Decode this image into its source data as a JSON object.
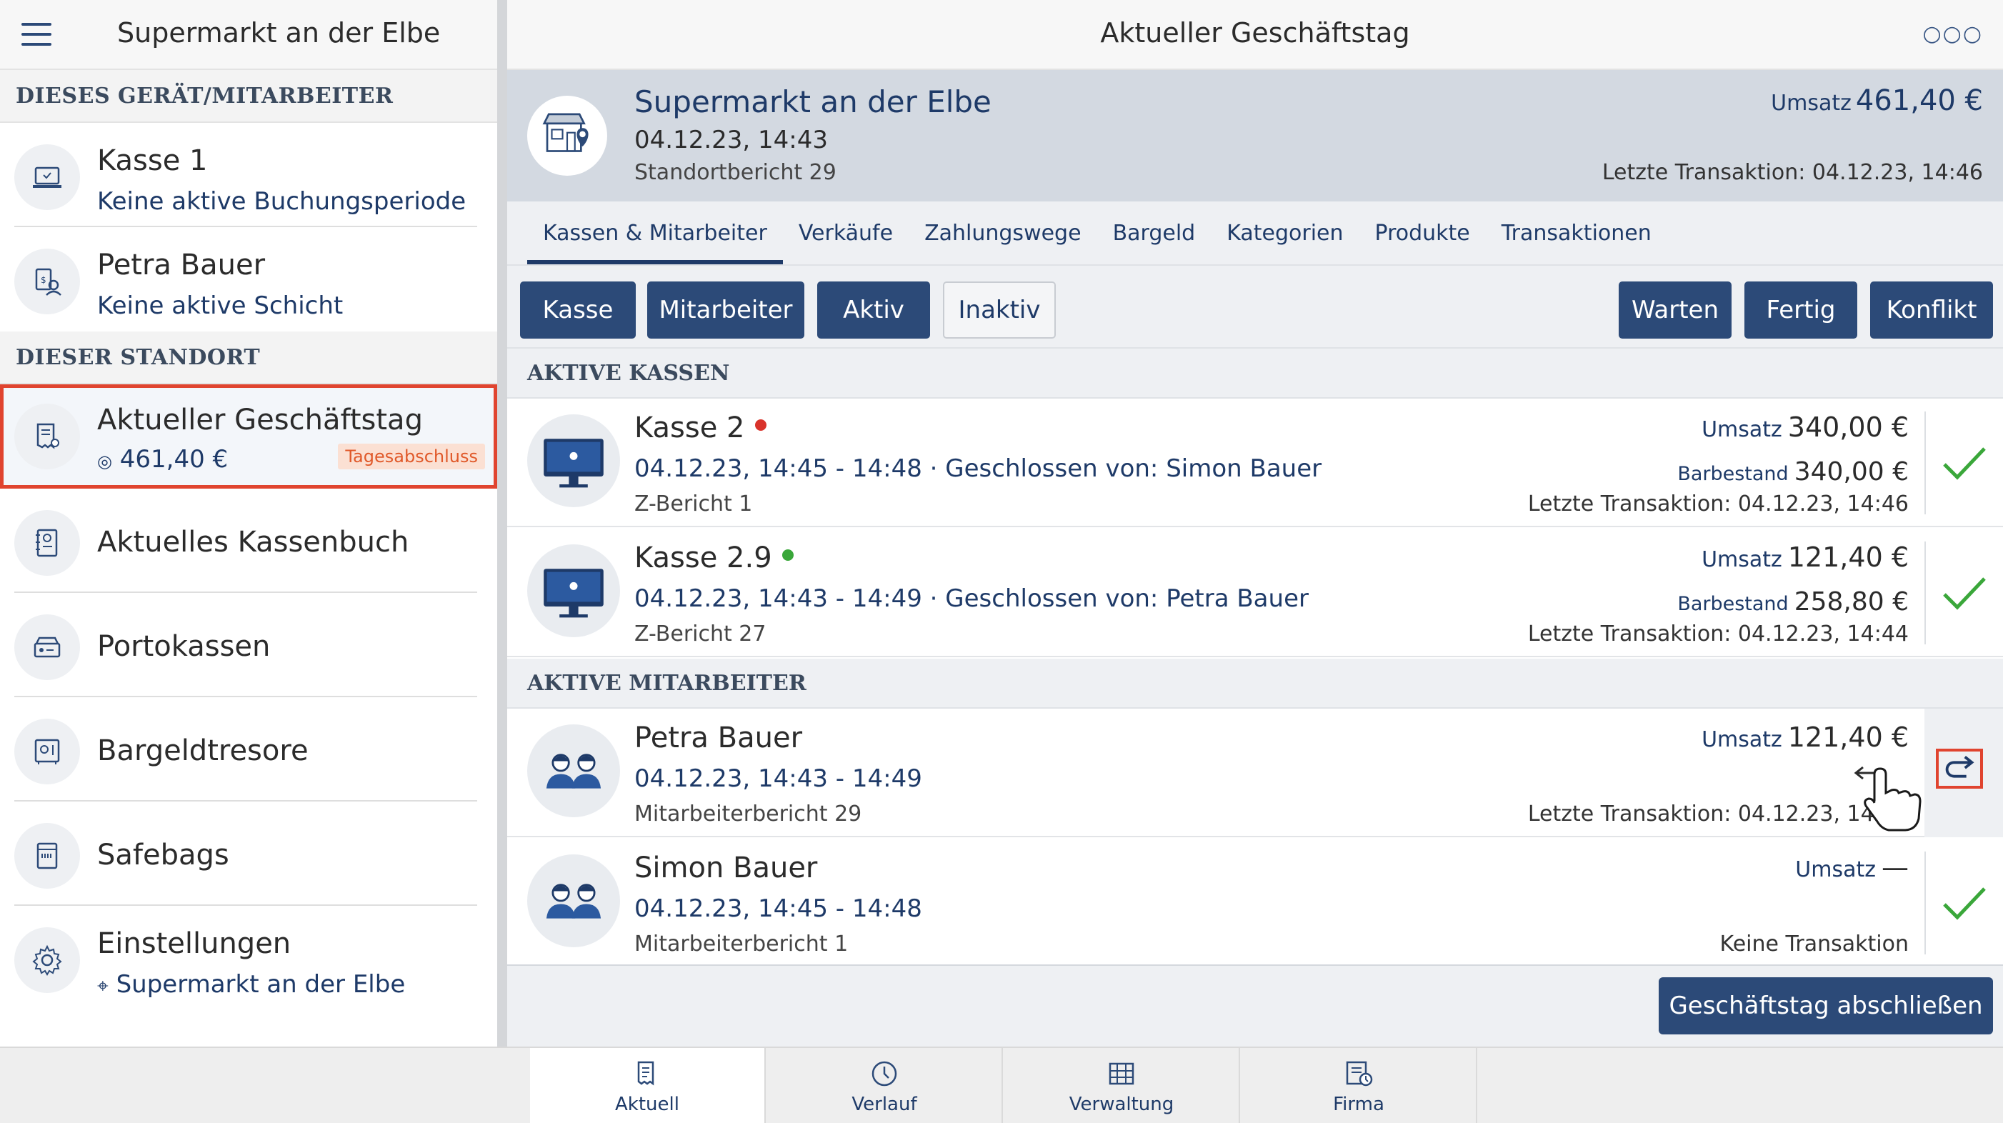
{
  "sidebar": {
    "title": "Supermarkt an der Elbe",
    "section_device": "DIESES GERÄT/MITARBEITER",
    "section_location": "DIESER STANDORT",
    "items": [
      {
        "title": "Kasse 1",
        "subtitle": "Keine aktive Buchungsperiode",
        "icon": "register-icon"
      },
      {
        "title": "Petra Bauer",
        "subtitle": "Keine aktive Schicht",
        "icon": "employee-icon"
      },
      {
        "title": "Aktueller Geschäftstag",
        "subtitle": "461,40 €",
        "badge": "Tagesabschluss",
        "icon": "receipt-icon"
      },
      {
        "title": "Aktuelles Kassenbuch",
        "icon": "cashbook-icon"
      },
      {
        "title": "Portokassen",
        "icon": "petty-cash-icon"
      },
      {
        "title": "Bargeldtresore",
        "icon": "safe-icon"
      },
      {
        "title": "Safebags",
        "icon": "safebag-icon"
      },
      {
        "title": "Einstellungen",
        "subtitle": "Supermarkt an der Elbe",
        "icon": "gear-icon"
      }
    ]
  },
  "header": {
    "title": "Aktueller Geschäftstag"
  },
  "banner": {
    "name": "Supermarkt an der Elbe",
    "date": "04.12.23, 14:43",
    "report": "Standortbericht 29",
    "revenue_label": "Umsatz",
    "revenue": "461,40 €",
    "last_transaction": "Letzte Transaktion: 04.12.23, 14:46"
  },
  "tabs": [
    "Kassen & Mitarbeiter",
    "Verkäufe",
    "Zahlungswege",
    "Bargeld",
    "Kategorien",
    "Produkte",
    "Transaktionen"
  ],
  "filters": {
    "kasse": "Kasse",
    "mitarbeiter": "Mitarbeiter",
    "aktiv": "Aktiv",
    "inaktiv": "Inaktiv",
    "warten": "Warten",
    "fertig": "Fertig",
    "konflikt": "Konflikt"
  },
  "registers": {
    "heading": "AKTIVE KASSEN",
    "items": [
      {
        "name": "Kasse 2",
        "status_color": "#d9332b",
        "period": "04.12.23, 14:45 - 14:48 · Geschlossen von: Simon Bauer",
        "report": "Z-Bericht 1",
        "revenue_label": "Umsatz",
        "revenue": "340,00 €",
        "cash_label": "Barbestand",
        "cash": "340,00 €",
        "last": "Letzte Transaktion: 04.12.23, 14:46"
      },
      {
        "name": "Kasse 2.9",
        "status_color": "#3aa73a",
        "period": "04.12.23, 14:43 - 14:49 · Geschlossen von: Petra Bauer",
        "report": "Z-Bericht 27",
        "revenue_label": "Umsatz",
        "revenue": "121,40 €",
        "cash_label": "Barbestand",
        "cash": "258,80 €",
        "last": "Letzte Transaktion: 04.12.23, 14:44"
      }
    ]
  },
  "employees": {
    "heading": "AKTIVE MITARBEITER",
    "items": [
      {
        "name": "Petra Bauer",
        "period": "04.12.23, 14:43 - 14:49",
        "report": "Mitarbeiterbericht 29",
        "revenue_label": "Umsatz",
        "revenue": "121,40 €",
        "last": "Letzte Transaktion: 04.12.23, 14:44"
      },
      {
        "name": "Simon Bauer",
        "period": "04.12.23, 14:45 - 14:48",
        "report": "Mitarbeiterbericht 1",
        "revenue_label": "Umsatz",
        "revenue": "—",
        "last": "Keine Transaktion"
      }
    ]
  },
  "actions": {
    "close_day": "Geschäftstag abschließen"
  },
  "bottom_nav": [
    "Aktuell",
    "Verlauf",
    "Verwaltung",
    "Firma"
  ],
  "colors": {
    "primary": "#2c4a78",
    "accent_red": "#e0442f",
    "check_green": "#3aa73a",
    "badge_bg": "#fbe0d3"
  }
}
